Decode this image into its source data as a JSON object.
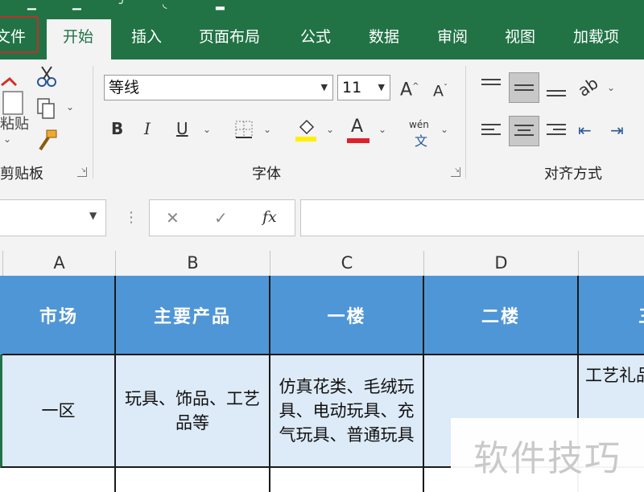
{
  "ribbon_tabs": {
    "file": "文件",
    "home": "开始",
    "insert": "插入",
    "page_layout": "页面布局",
    "formulas": "公式",
    "data": "数据",
    "review": "审阅",
    "view": "视图",
    "addins": "加载项"
  },
  "clipboard": {
    "paste_label": "粘贴",
    "group_label": "剪贴板"
  },
  "font": {
    "font_name": "等线",
    "font_size": "11",
    "bold": "B",
    "italic": "I",
    "underline": "U",
    "font_color_glyph": "A",
    "phonetic_top": "wén",
    "phonetic_bottom": "文",
    "group_label": "字体",
    "fill_color": "#ffef00",
    "font_color": "#e0202a"
  },
  "alignment": {
    "group_label": "对齐方式"
  },
  "formula_bar": {
    "cancel": "✕",
    "enter": "✓",
    "fx": "fx",
    "value": ""
  },
  "columns": [
    "A",
    "B",
    "C",
    "D"
  ],
  "table": {
    "headers": [
      "市场",
      "主要产品",
      "一楼",
      "二楼",
      "三"
    ],
    "row1": [
      "一区",
      "玩具、饰品、工艺品等",
      "仿真花类、毛绒玩具、电动玩具、充气玩具、普通玩具",
      "",
      "工艺礼品"
    ]
  },
  "watermark": "软件技巧",
  "colors": {
    "ribbon": "#217346",
    "header_fill": "#4f96d6",
    "data_fill": "#ddeaf7"
  }
}
